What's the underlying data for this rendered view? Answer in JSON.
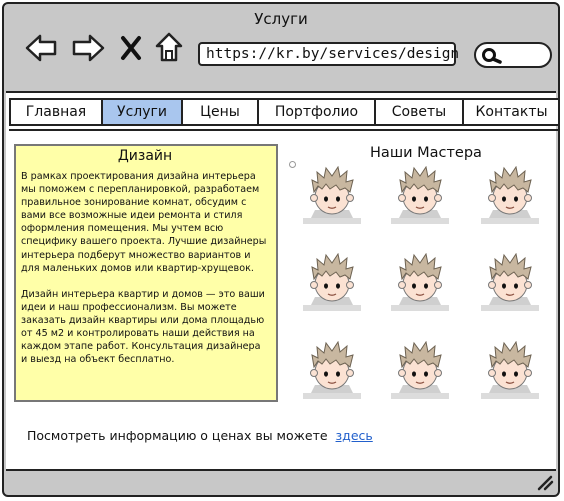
{
  "window": {
    "title": "Услуги"
  },
  "browser": {
    "url": "https://kr.by/services/design",
    "icons": [
      "back-arrow-icon",
      "forward-arrow-icon",
      "close-x-icon",
      "home-icon",
      "search-icon",
      "resize-grip-icon"
    ]
  },
  "nav": {
    "tabs": [
      {
        "label": "Главная",
        "active": false
      },
      {
        "label": "Услуги",
        "active": true
      },
      {
        "label": "Цены",
        "active": false
      },
      {
        "label": "Портфолио",
        "active": false
      },
      {
        "label": "Советы",
        "active": false
      },
      {
        "label": "Контакты",
        "active": false
      }
    ]
  },
  "design": {
    "title": "Дизайн",
    "paragraph1": "В рамках проектирования дизайна интерьера мы поможем с перепланировкой, разработаем правильное зонирование комнат, обсудим с вами все возможные идеи ремонта и стиля оформления помещения. Мы учтем всю специфику вашего проекта. Лучшие дизайнеры интерьера подберут множество вариантов и для маленьких домов или квартир-хрущевок.",
    "paragraph2": "Дизайн интерьера квартир и домов — это ваши идеи и наш профессионализм. Вы можете заказать дизайн квартиры или дома площадью от 45 м2 и контролировать наши действия на каждом этапе работ. Консультация дизайнера и выезд на объект бесплатно."
  },
  "masters": {
    "title": "Наши Мастера",
    "count": 9
  },
  "footer": {
    "prices_text": "Посмотреть информацию о ценах вы можете",
    "prices_link": "здесь"
  },
  "colors": {
    "chrome": "#c8c8c8",
    "active_tab": "#a9c6ee",
    "note_background": "#ffffa8",
    "link": "#2260cc"
  }
}
